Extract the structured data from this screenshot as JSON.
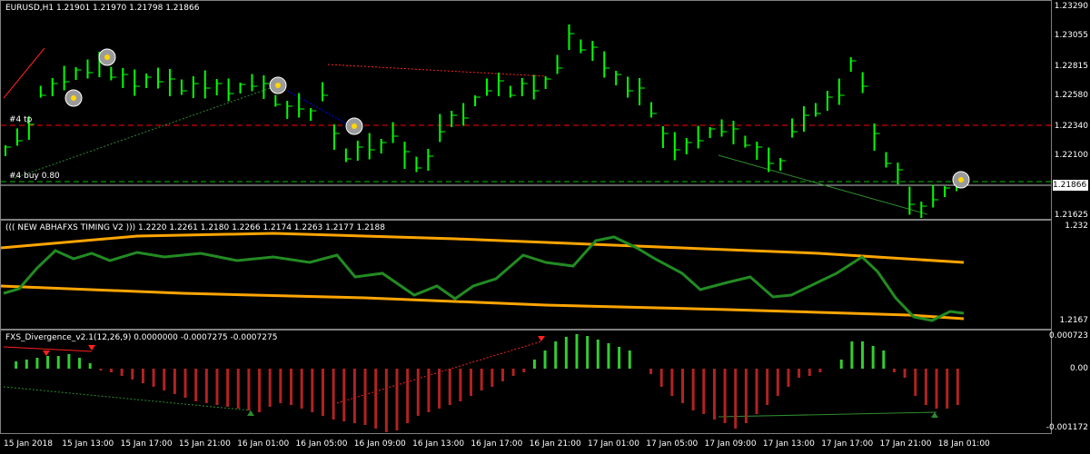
{
  "main": {
    "caption": "EURUSD,H1  1.21901 1.21970 1.21798 1.21866",
    "price_labels": [
      "1.23290",
      "1.23055",
      "1.22815",
      "1.22580",
      "1.22340",
      "1.22100",
      "1.21625"
    ],
    "current_price": "1.21866",
    "level_tp": "#4 tp",
    "level_buy": "#4 buy 0.80"
  },
  "ind1": {
    "caption": "((( NEW ABHAFXS TIMING V2 )))  1.2220 1.2261 1.2180 1.2266 1.2174 1.2263 1.2177 1.2188",
    "top_label": "1.232",
    "bottom_label": "1.2167"
  },
  "ind2": {
    "caption": "FXS_Divergence_v2.1(12,26,9) 0.0000000 -0.0007275 -0.0007275",
    "labels": [
      "0.000723",
      "0.00",
      "-0.001172"
    ]
  },
  "time_axis": [
    "15 Jan 2018",
    "15 Jan 13:00",
    "15 Jan 17:00",
    "15 Jan 21:00",
    "16 Jan 01:00",
    "16 Jan 05:00",
    "16 Jan 09:00",
    "16 Jan 13:00",
    "16 Jan 17:00",
    "16 Jan 21:00",
    "17 Jan 01:00",
    "17 Jan 05:00",
    "17 Jan 09:00",
    "17 Jan 13:00",
    "17 Jan 17:00",
    "17 Jan 21:00",
    "18 Jan 01:00"
  ],
  "colors": {
    "bar": "#00ff00",
    "osc_line": "#228b22",
    "band": "#ffa500",
    "hist_up": "#32cd32",
    "hist_down": "#b22222",
    "tp_line": "#ff0000",
    "buy_line": "#00c000"
  }
}
